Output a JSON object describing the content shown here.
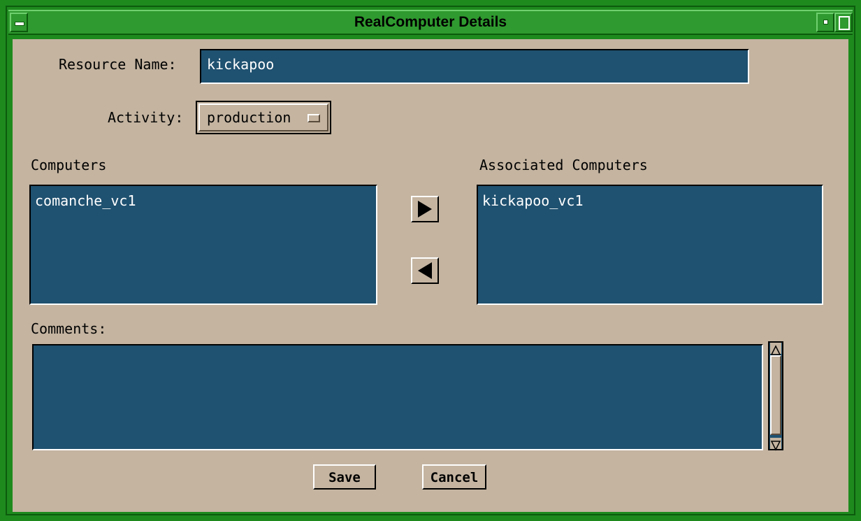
{
  "window": {
    "title": "RealComputer Details"
  },
  "form": {
    "resource_name_label": "Resource Name:",
    "resource_name_value": "kickapoo",
    "activity_label": "Activity:",
    "activity_value": "production",
    "computers_label": "Computers",
    "computers": [
      "comanche_vc1"
    ],
    "associated_label": "Associated Computers",
    "associated": [
      "kickapoo_vc1"
    ],
    "comments_label": "Comments:",
    "comments_value": ""
  },
  "buttons": {
    "save": "Save",
    "cancel": "Cancel"
  },
  "colors": {
    "frame": "#1e8a1e",
    "background": "#c4b4a0",
    "field": "#1f5170"
  },
  "icons": {
    "add": "right-triangle-arrow-icon",
    "remove": "left-triangle-arrow-icon",
    "scroll_up": "up-arrow-icon",
    "scroll_down": "down-arrow-icon"
  }
}
